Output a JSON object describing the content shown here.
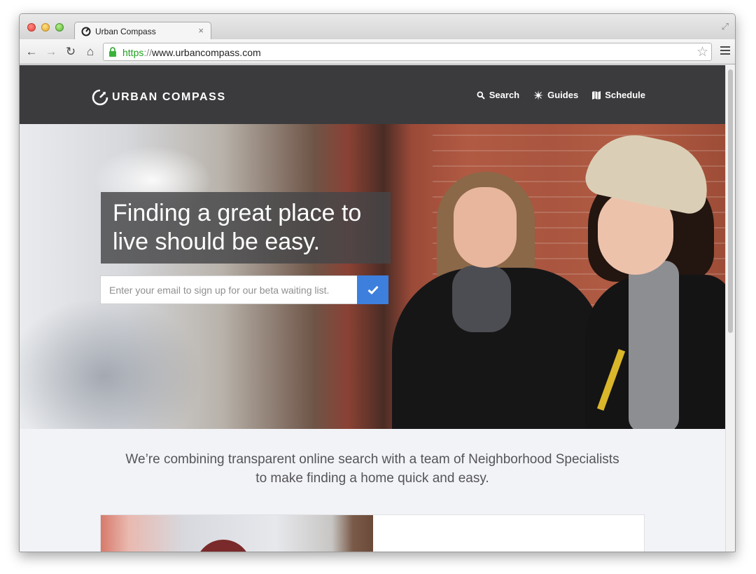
{
  "browser": {
    "tab_title": "Urban Compass",
    "tab_close": "×",
    "url_scheme": "https",
    "url_sep": "://",
    "url_host": "www.urbancompass.com",
    "nav_back": "←",
    "nav_forward": "→",
    "nav_reload": "↻",
    "nav_home": "⌂",
    "bookmark_star": "☆",
    "fullscreen": "⤢"
  },
  "site": {
    "logo_text": "URBAN COMPASS",
    "nav": [
      {
        "label": "Search",
        "icon": "search-icon"
      },
      {
        "label": "Guides",
        "icon": "compass-star-icon"
      },
      {
        "label": "Schedule",
        "icon": "map-icon"
      }
    ]
  },
  "hero": {
    "headline": "Finding a great place to live should be easy.",
    "email_placeholder": "Enter your email to sign up for our beta waiting list.",
    "submit_icon": "checkmark-icon"
  },
  "intro": {
    "tagline": "We’re combining transparent online search with a team of Neighborhood Specialists to make finding a home quick and easy."
  },
  "colors": {
    "header_bg": "#3b3b3e",
    "accent_blue": "#3d7fdc",
    "page_bg": "#f2f3f7",
    "secure_green": "#1e9e1e"
  }
}
